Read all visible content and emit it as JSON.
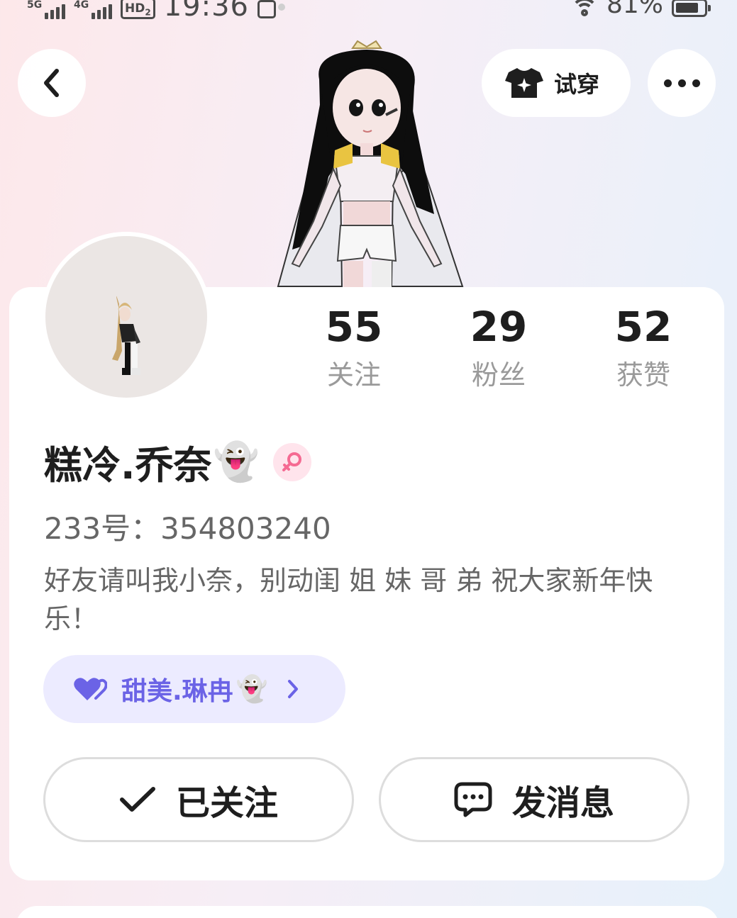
{
  "status_bar": {
    "net1": "5G",
    "net2": "4G",
    "hd": "HD",
    "hd_sub": "2",
    "time": "19:36",
    "battery_pct": "81%",
    "battery_level": 0.81
  },
  "header": {
    "back_icon": "chevron-left-icon",
    "tryon_label": "试穿",
    "tryon_icon": "tshirt-sparkle-icon",
    "more_icon": "more-dots-icon"
  },
  "stats": [
    {
      "value": "55",
      "label": "关注"
    },
    {
      "value": "29",
      "label": "粉丝"
    },
    {
      "value": "52",
      "label": "获赞"
    }
  ],
  "profile": {
    "name": "糕冷.乔奈",
    "name_emoji": "👻",
    "gender_icon": "female-icon",
    "uid": "233号：354803240",
    "bio": "好友请叫我小奈，别动闺 姐 妹 哥 弟   祝大家新年快乐！"
  },
  "couple": {
    "icon": "double-heart-icon",
    "name": "甜美.琳冉",
    "emoji": "👻",
    "arrow_icon": "chevron-right-icon"
  },
  "actions": {
    "follow_label": "已关注",
    "follow_icon": "check-icon",
    "message_label": "发消息",
    "message_icon": "chat-bubble-icon"
  },
  "colors": {
    "accent_purple": "#6b63e6",
    "couple_bg": "#ecebff",
    "gender_bg": "#ffe4ec",
    "gender_fg": "#f56a92"
  }
}
